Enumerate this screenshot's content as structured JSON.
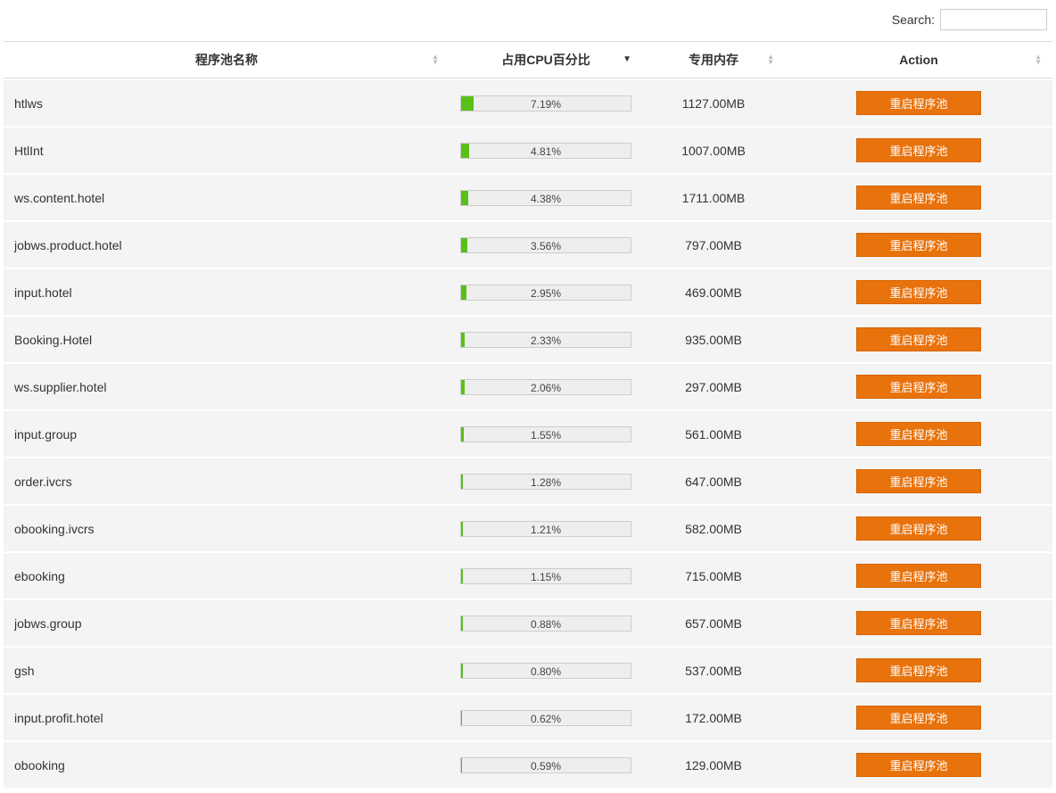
{
  "search": {
    "label": "Search:",
    "value": ""
  },
  "columns": {
    "name": "程序池名称",
    "cpu": "占用CPU百分比",
    "memory": "专用内存",
    "action": "Action"
  },
  "active_sort": {
    "column": "cpu",
    "direction": "desc"
  },
  "action_button_label": "重启程序池",
  "rows": [
    {
      "name": "htlws",
      "cpu_pct": "7.19%",
      "cpu_val": 7.19,
      "memory": "1127.00MB"
    },
    {
      "name": "HtlInt",
      "cpu_pct": "4.81%",
      "cpu_val": 4.81,
      "memory": "1007.00MB"
    },
    {
      "name": "ws.content.hotel",
      "cpu_pct": "4.38%",
      "cpu_val": 4.38,
      "memory": "1711.00MB"
    },
    {
      "name": "jobws.product.hotel",
      "cpu_pct": "3.56%",
      "cpu_val": 3.56,
      "memory": "797.00MB"
    },
    {
      "name": "input.hotel",
      "cpu_pct": "2.95%",
      "cpu_val": 2.95,
      "memory": "469.00MB"
    },
    {
      "name": "Booking.Hotel",
      "cpu_pct": "2.33%",
      "cpu_val": 2.33,
      "memory": "935.00MB"
    },
    {
      "name": "ws.supplier.hotel",
      "cpu_pct": "2.06%",
      "cpu_val": 2.06,
      "memory": "297.00MB"
    },
    {
      "name": "input.group",
      "cpu_pct": "1.55%",
      "cpu_val": 1.55,
      "memory": "561.00MB"
    },
    {
      "name": "order.ivcrs",
      "cpu_pct": "1.28%",
      "cpu_val": 1.28,
      "memory": "647.00MB"
    },
    {
      "name": "obooking.ivcrs",
      "cpu_pct": "1.21%",
      "cpu_val": 1.21,
      "memory": "582.00MB"
    },
    {
      "name": "ebooking",
      "cpu_pct": "1.15%",
      "cpu_val": 1.15,
      "memory": "715.00MB"
    },
    {
      "name": "jobws.group",
      "cpu_pct": "0.88%",
      "cpu_val": 0.88,
      "memory": "657.00MB"
    },
    {
      "name": "gsh",
      "cpu_pct": "0.80%",
      "cpu_val": 0.8,
      "memory": "537.00MB"
    },
    {
      "name": "input.profit.hotel",
      "cpu_pct": "0.62%",
      "cpu_val": 0.62,
      "memory": "172.00MB"
    },
    {
      "name": "obooking",
      "cpu_pct": "0.59%",
      "cpu_val": 0.59,
      "memory": "129.00MB"
    }
  ]
}
